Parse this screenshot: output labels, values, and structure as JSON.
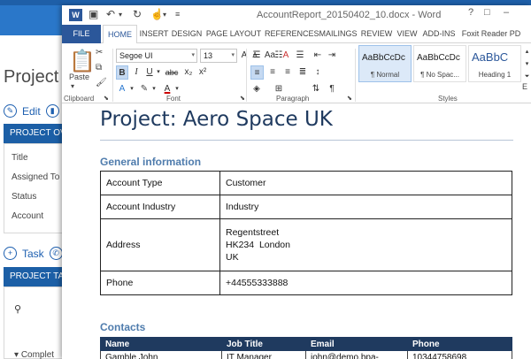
{
  "background_app": {
    "title": "Project",
    "edit_label": "Edit",
    "overview_header": "PROJECT OVE",
    "fields": [
      "Title",
      "Assigned To",
      "Status",
      "Account"
    ],
    "task_label": "Task",
    "tasks_header": "PROJECT TAS",
    "completed_label": "Complet"
  },
  "word": {
    "logo": "W",
    "doc_title": "AccountReport_20150402_10.docx - Word",
    "window_buttons": [
      "?",
      "–",
      "□",
      "✕"
    ],
    "tabs": [
      "FILE",
      "HOME",
      "INSERT",
      "DESIGN",
      "PAGE LAYOUT",
      "REFERENCES",
      "MAILINGS",
      "REVIEW",
      "VIEW",
      "ADD-INS",
      "Foxit Reader PD"
    ],
    "ribbon": {
      "paste_label": "Paste",
      "font_name": "Segoe UI",
      "font_size": "13",
      "groups": [
        "Clipboard",
        "Font",
        "Paragraph",
        "Styles"
      ],
      "styles": [
        {
          "sample": "AaBbCcDc",
          "name": "¶ Normal"
        },
        {
          "sample": "AaBbCcDc",
          "name": "¶ No Spac..."
        },
        {
          "sample": "AaBbC",
          "name": "Heading 1"
        }
      ],
      "edit_partial": "E"
    }
  },
  "document": {
    "title": "Project: Aero Space UK",
    "general_heading": "General information",
    "general_rows": [
      {
        "label": "Account Type",
        "value": "Customer"
      },
      {
        "label": "Account Industry",
        "value": "Industry"
      },
      {
        "label": "Address",
        "value_lines": [
          "Regentstreet",
          "HK234  London",
          "UK"
        ]
      },
      {
        "label": "Phone",
        "value": "+44555333888"
      }
    ],
    "contacts_heading": "Contacts",
    "contacts_columns": [
      "Name",
      "Job Title",
      "Email",
      "Phone"
    ],
    "contacts_rows": [
      [
        "Gamble John",
        "IT Manager",
        "john@demo.bpa-",
        "10344758698"
      ]
    ]
  },
  "colors": {
    "word_blue": "#2b579a",
    "crm_blue": "#1c5fa6",
    "doc_heading": "#1f3a5f",
    "section_heading": "#4f7cad"
  }
}
